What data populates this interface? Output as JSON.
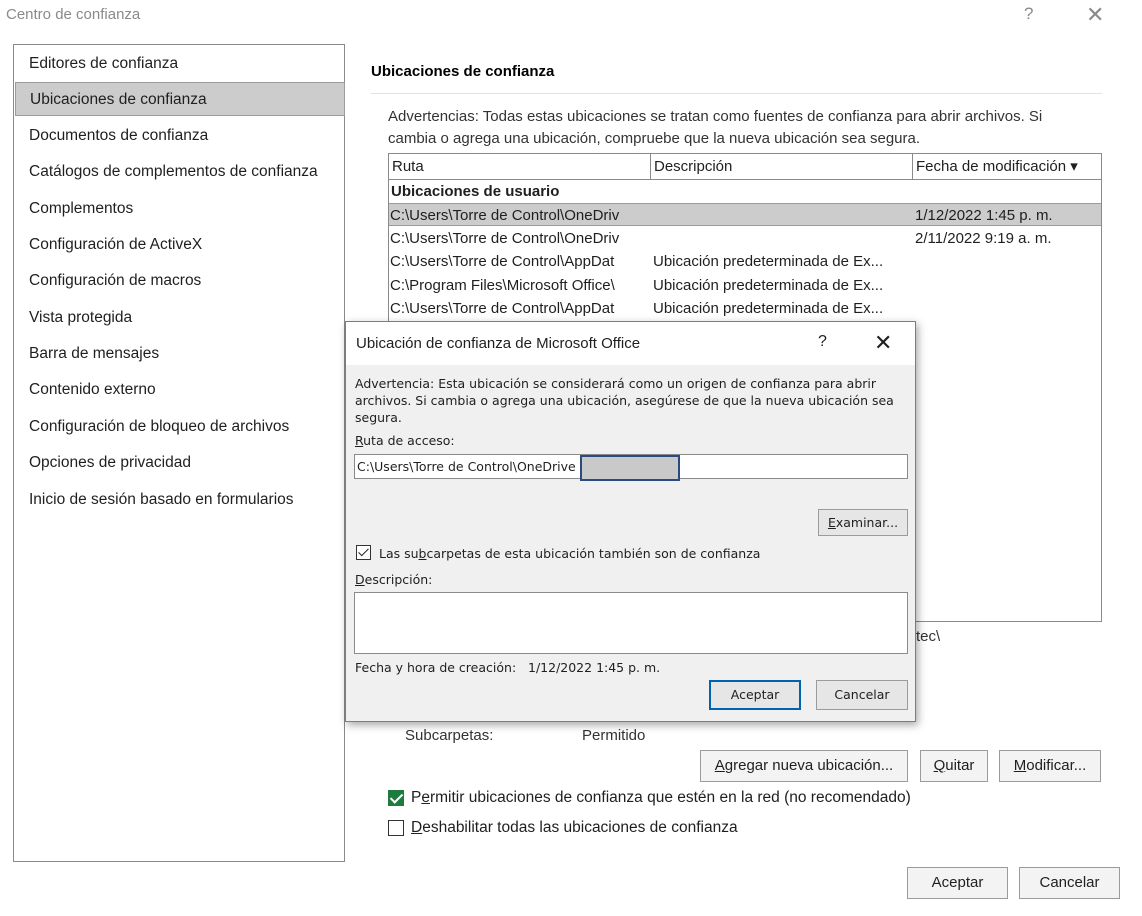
{
  "window": {
    "title": "Centro de confianza",
    "help_glyph": "?",
    "close_glyph": "✕"
  },
  "sidebar": {
    "items": [
      {
        "label": "Editores de confianza",
        "selected": false
      },
      {
        "label": "Ubicaciones de confianza",
        "selected": true
      },
      {
        "label": "Documentos de confianza",
        "selected": false
      },
      {
        "label": "Catálogos de complementos de confianza",
        "selected": false
      },
      {
        "label": "Complementos",
        "selected": false
      },
      {
        "label": "Configuración de ActiveX",
        "selected": false
      },
      {
        "label": "Configuración de macros",
        "selected": false
      },
      {
        "label": "Vista protegida",
        "selected": false
      },
      {
        "label": "Barra de mensajes",
        "selected": false
      },
      {
        "label": "Contenido externo",
        "selected": false
      },
      {
        "label": "Configuración de bloqueo de archivos",
        "selected": false
      },
      {
        "label": "Opciones de privacidad",
        "selected": false
      },
      {
        "label": "Inicio de sesión basado en formularios",
        "selected": false
      }
    ]
  },
  "main": {
    "section_title": "Ubicaciones de confianza",
    "warning": "Advertencias: Todas estas ubicaciones se tratan como fuentes de confianza para abrir archivos. Si cambia o agrega una ubicación, compruebe que la nueva ubicación sea segura.",
    "table": {
      "columns": [
        "Ruta",
        "Descripción",
        "Fecha de modificación"
      ],
      "sort_glyph": "▾",
      "group_label": "Ubicaciones de usuario",
      "rows": [
        {
          "path": "C:\\Users\\Torre de Control\\OneDriv",
          "description": "",
          "date": "1/12/2022 1:45 p. m.",
          "selected": true
        },
        {
          "path": "C:\\Users\\Torre de Control\\OneDriv",
          "description": "",
          "date": "2/11/2022 9:19 a. m.",
          "selected": false
        },
        {
          "path": "C:\\Users\\Torre de Control\\AppDat",
          "description": "Ubicación predeterminada de Ex...",
          "date": "",
          "selected": false
        },
        {
          "path": "C:\\Program Files\\Microsoft Office\\",
          "description": "Ubicación predeterminada de Ex...",
          "date": "",
          "selected": false
        },
        {
          "path": "C:\\Users\\Torre de Control\\AppDat",
          "description": "Ubicación predeterminada de Ex...",
          "date": "",
          "selected": false
        }
      ]
    },
    "path_fragment": "tec\\",
    "subfolders_label": "Subcarpetas:",
    "subfolders_value": "Permitido",
    "buttons": {
      "add": {
        "pre": "",
        "key": "A",
        "post": "gregar nueva ubicación..."
      },
      "remove": {
        "pre": "",
        "key": "Q",
        "post": "uitar"
      },
      "modify": {
        "pre": "",
        "key": "M",
        "post": "odificar..."
      }
    },
    "allow_network": {
      "pre": "P",
      "key": "e",
      "post": "rmitir ubicaciones de confianza que estén en la red (no recomendado)",
      "checked": true
    },
    "disable_all": {
      "pre": "",
      "key": "D",
      "post": "eshabilitar todas las ubicaciones de confianza",
      "checked": false
    }
  },
  "footer": {
    "ok": "Aceptar",
    "cancel": "Cancelar"
  },
  "dialog": {
    "title": "Ubicación de confianza de Microsoft Office",
    "help_glyph": "?",
    "close_glyph": "✕",
    "warning_lines": [
      "Advertencia: Esta ubicación se considerará como un origen de confianza para abrir",
      "archivos. Si cambia o agrega una ubicación, asegúrese de que la nueva ubicación sea",
      "segura."
    ],
    "path_label": {
      "key": "R",
      "post": "uta de acceso:"
    },
    "path_value": "C:\\Users\\Torre de Control\\OneDrive",
    "browse": {
      "key": "E",
      "post": "xaminar..."
    },
    "subfolders": {
      "pre": "Las su",
      "key": "b",
      "post": "carpetas de esta ubicación también son de confianza",
      "checked": true
    },
    "description_label": {
      "key": "D",
      "post": "escripción:"
    },
    "description_value": "",
    "created_label": "Fecha y hora de creación:",
    "created_value": "1/12/2022 1:45 p. m.",
    "ok": "Aceptar",
    "cancel": "Cancelar"
  }
}
